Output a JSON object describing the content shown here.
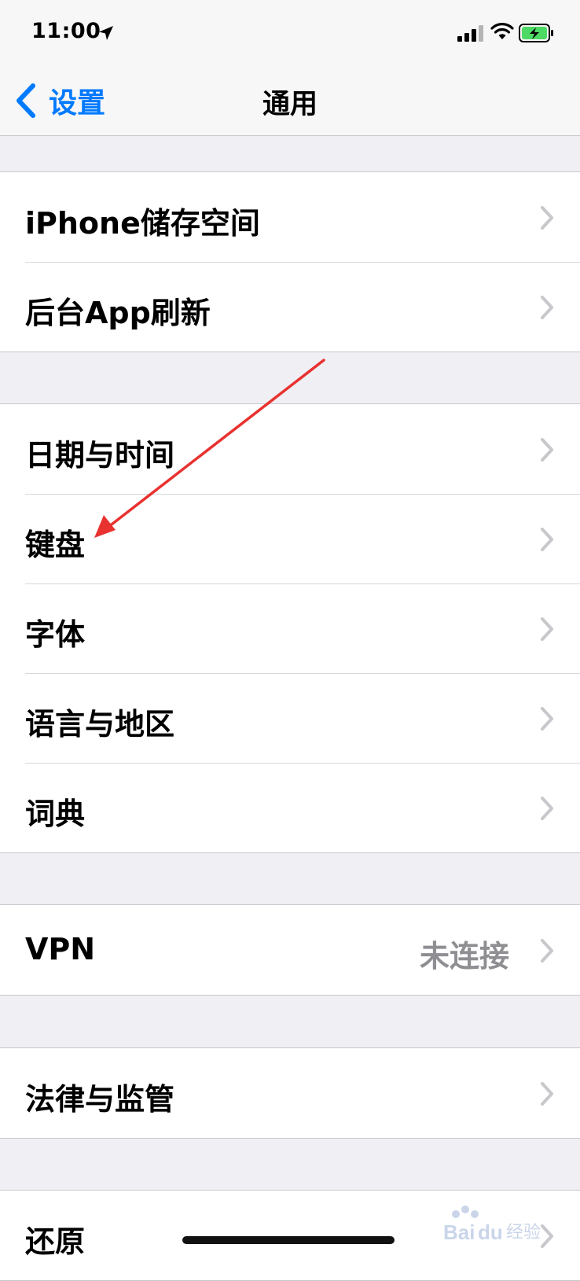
{
  "status_bar": {
    "time": "11:00",
    "location_icon": "location-arrow-icon",
    "signal_icon": "cellular-signal-icon",
    "wifi_icon": "wifi-icon",
    "battery_icon": "battery-charging-icon"
  },
  "nav": {
    "back_label": "设置",
    "title": "通用"
  },
  "groups": [
    {
      "rows": [
        {
          "label": "iPhone储存空间"
        },
        {
          "label": "后台App刷新"
        }
      ]
    },
    {
      "rows": [
        {
          "label": "日期与时间"
        },
        {
          "label": "键盘"
        },
        {
          "label": "字体"
        },
        {
          "label": "语言与地区"
        },
        {
          "label": "词典"
        }
      ]
    },
    {
      "rows": [
        {
          "label": "VPN",
          "value": "未连接"
        }
      ]
    },
    {
      "rows": [
        {
          "label": "法律与监管"
        }
      ]
    },
    {
      "rows": [
        {
          "label": "还原"
        }
      ]
    }
  ],
  "colors": {
    "accent": "#007aff",
    "background": "#efeff4",
    "annotation_arrow": "#e8322f",
    "battery": "#4cd964"
  },
  "watermark_text": "Baidu经验"
}
